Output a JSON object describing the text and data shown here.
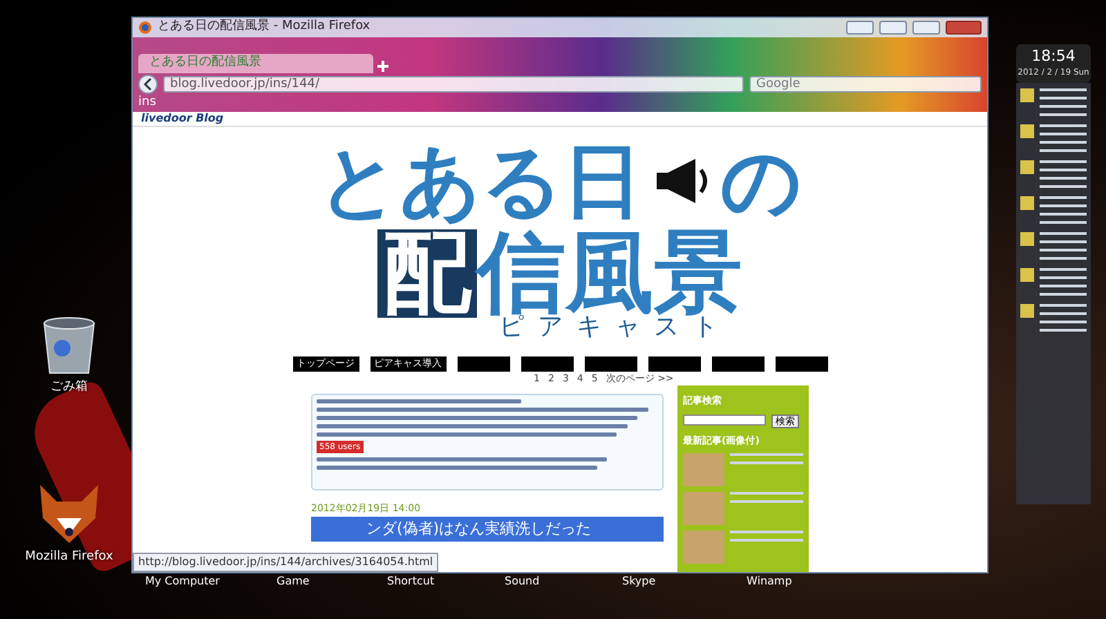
{
  "desktop_icons": [
    {
      "label": "ごみ箱",
      "kind": "trash"
    },
    {
      "label": "Mozilla Firefox",
      "kind": "fox"
    }
  ],
  "taskbar_labels": [
    "My Computer",
    "Game",
    "Shortcut",
    "Sound",
    "Skype",
    "Winamp"
  ],
  "clock": {
    "time": "18:54",
    "date": "2012 / 2 / 19 Sun"
  },
  "browser": {
    "title": "とある日の配信風景 - Mozilla Firefox",
    "tabs": [
      {
        "label": "とある日の配信風景",
        "selected": true
      }
    ],
    "url": "blog.livedoor.jp/ins/144/",
    "search_placeholder": "Google",
    "bookmarks": [
      "ins"
    ],
    "status_url": "http://blog.livedoor.jp/ins/144/archives/3164054.html"
  },
  "page": {
    "brand": "livedoor Blog",
    "logo": {
      "line1_start": "とある日",
      "line1_end": "の",
      "boxed_char": "配",
      "line2_rest": "信風景",
      "reading": "ピアキャスト"
    },
    "nav": [
      {
        "kind": "text",
        "label": "トップページ"
      },
      {
        "kind": "text",
        "label": "ピアキャス導入"
      },
      {
        "kind": "blank"
      },
      {
        "kind": "blank"
      },
      {
        "kind": "blank"
      },
      {
        "kind": "blank"
      },
      {
        "kind": "blank"
      },
      {
        "kind": "blank"
      }
    ],
    "pagination": [
      "1",
      "2",
      "3",
      "4",
      "5",
      "次のページ >>"
    ],
    "feed_badge": "558 users",
    "post_date": "2012年02月19日 14:00",
    "post_title": "ンダ(偽者)はなん実績洗しだった",
    "sidebar": {
      "search_heading": "記事検索",
      "search_button": "検索",
      "recent_heading": "最新記事(画像付)"
    }
  }
}
